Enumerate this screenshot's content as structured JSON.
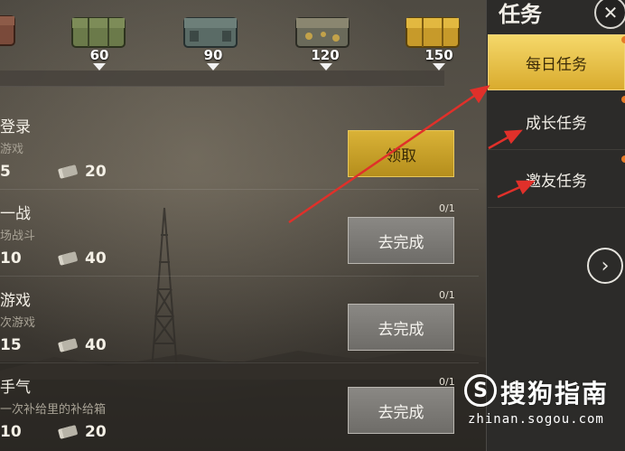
{
  "rewards": {
    "milestones": [
      {
        "value": "60",
        "tint": "#6b7a4a"
      },
      {
        "value": "90",
        "tint": "#5a6b66"
      },
      {
        "value": "120",
        "tint": "#6a6a5a"
      },
      {
        "value": "150",
        "tint": "#c79a2a"
      }
    ]
  },
  "tasks": [
    {
      "title": "登录",
      "subtitle": "游戏",
      "xp": "5",
      "coins": "20",
      "progress": "",
      "button": "领取",
      "button_style": "gold"
    },
    {
      "title": "一战",
      "subtitle": "场战斗",
      "xp": "10",
      "coins": "40",
      "progress": "0/1",
      "button": "去完成",
      "button_style": "gray"
    },
    {
      "title": "游戏",
      "subtitle": "次游戏",
      "xp": "15",
      "coins": "40",
      "progress": "0/1",
      "button": "去完成",
      "button_style": "gray"
    },
    {
      "title": "手气",
      "subtitle": "一次补给里的补给箱",
      "xp": "10",
      "coins": "20",
      "progress": "0/1",
      "button": "去完成",
      "button_style": "gray"
    }
  ],
  "sidebar": {
    "title": "任务",
    "close_icon": "close-icon",
    "tabs": [
      {
        "label": "每日任务",
        "active": true
      },
      {
        "label": "成长任务",
        "active": false
      },
      {
        "label": "邀友任务",
        "active": false
      }
    ],
    "next_icon": "chevron-right-icon"
  },
  "watermark": {
    "logo": "S",
    "name": "搜狗指南",
    "url": "zhinan.sogou.com"
  },
  "colors": {
    "gold": "#d9b237",
    "annotation_red": "#e0302a"
  }
}
